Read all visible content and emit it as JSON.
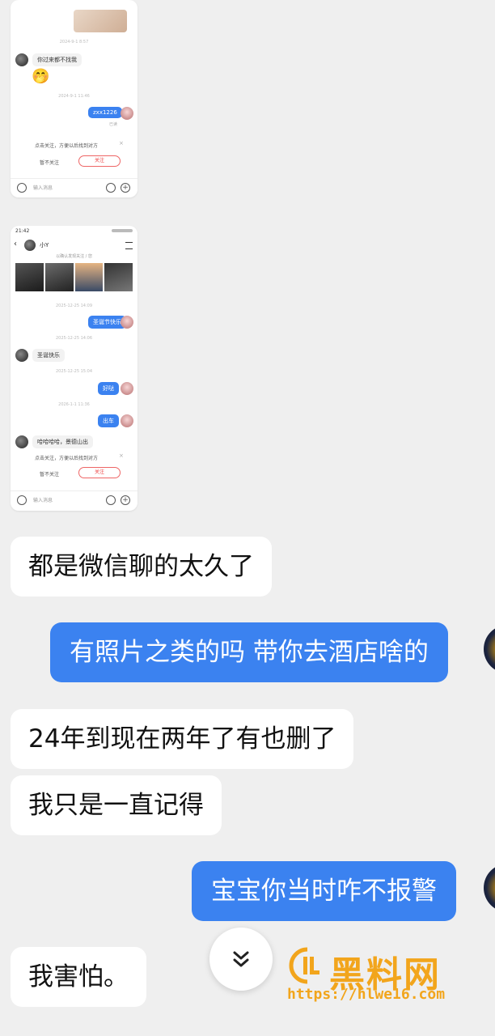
{
  "shot1": {
    "time1": "2024-9-1 8:57",
    "msg_left": "你过来都不找我",
    "emoji": "🤭",
    "time2": "2024-9-1 11:46",
    "msg_right": "zxx1226",
    "read": "已读",
    "follow_prompt": "点击关注，方便以后找到对方",
    "skip": "暂不关注",
    "follow": "关注",
    "input_placeholder": "输入消息"
  },
  "shot2": {
    "status_time": "21:42",
    "contact_name": "小Y",
    "sub_caption": "以确认发现关注 / 您",
    "time1": "2025-12-25 14:09",
    "msg_r1": "圣诞节快乐",
    "time2": "2025-12-25 14:06",
    "msg_l1": "圣诞快乐",
    "time3": "2025-12-25 15:04",
    "msg_r2": "好哒",
    "time4": "2026-1-1 11:36",
    "msg_r3": "出车",
    "msg_l2": "哈哈哈哈，景德山出",
    "follow_prompt": "点击关注，方便以后找到对方",
    "skip": "暂不关注",
    "follow": "关注",
    "input_placeholder": "输入消息"
  },
  "messages": [
    {
      "side": "left",
      "text": "都是微信聊的太久了"
    },
    {
      "side": "right",
      "text": "有照片之类的吗 带你去酒店啥的"
    },
    {
      "side": "left",
      "text": "24年到现在两年了有也删了"
    },
    {
      "side": "left",
      "text": "我只是一直记得"
    },
    {
      "side": "right",
      "text": "宝宝你当时咋不报警"
    },
    {
      "side": "left",
      "text": "我害怕。"
    }
  ],
  "watermark": {
    "title": "黑料网",
    "url": "https://hlwe16.com"
  },
  "colors": {
    "accent_blue": "#3b82f0",
    "watermark_orange": "#f2a51c",
    "background": "#efefef"
  },
  "icons": {
    "scroll_down": "double-chevron-down-icon"
  }
}
